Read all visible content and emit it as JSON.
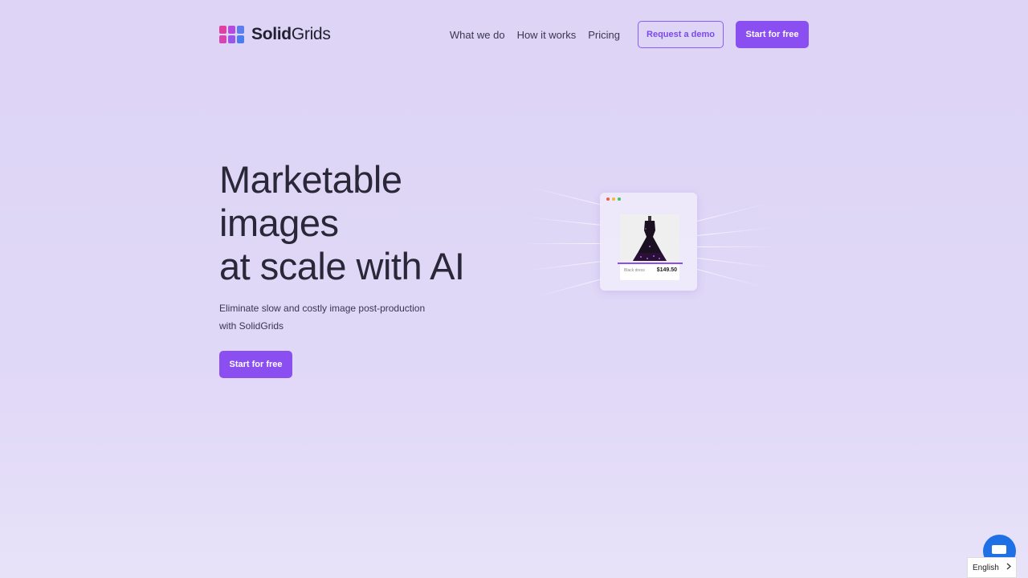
{
  "brand": {
    "name_bold": "Solid",
    "name_light": "Grids",
    "logo_colors": [
      "#e040a0",
      "#c04ad8",
      "#9b5cf0",
      "#e04aa8",
      "#b450e0",
      "#4c7df0"
    ]
  },
  "nav": {
    "links": [
      "What we do",
      "How it works",
      "Pricing"
    ],
    "demo_label": "Request a demo",
    "start_label": "Start for free"
  },
  "hero": {
    "title_lines": [
      "Marketable",
      "images",
      "at scale with AI"
    ],
    "subtitle_lines": [
      "Eliminate slow and costly image post-production",
      "with SolidGrids"
    ],
    "cta_label": "Start for free"
  },
  "illustration": {
    "window_dot_colors": [
      "#f05a4a",
      "#f5b53a",
      "#3ec45a"
    ],
    "product_name": "Black dress",
    "product_price": "$149.50"
  },
  "language": {
    "current": "English"
  },
  "colors": {
    "accent": "#8b4ef0",
    "chat": "#1f6fe5"
  }
}
